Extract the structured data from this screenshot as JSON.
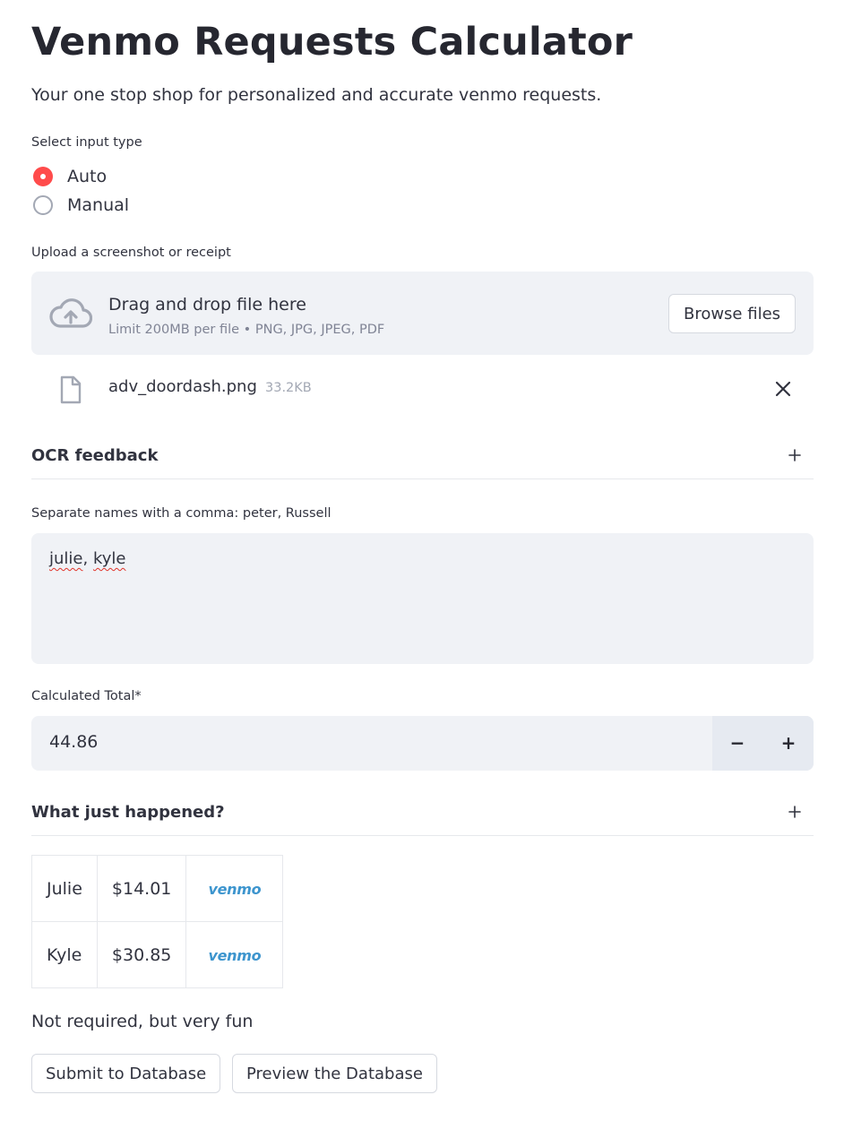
{
  "header": {
    "title": "Venmo Requests Calculator",
    "subtitle": "Your one stop shop for personalized and accurate venmo requests."
  },
  "input_type": {
    "label": "Select input type",
    "options": [
      {
        "label": "Auto",
        "selected": true
      },
      {
        "label": "Manual",
        "selected": false
      }
    ]
  },
  "uploader": {
    "label": "Upload a screenshot or receipt",
    "drag_text": "Drag and drop file here",
    "limit_text": "Limit 200MB per file • PNG, JPG, JPEG, PDF",
    "browse_label": "Browse files",
    "file": {
      "name": "adv_doordash.png",
      "size": "33.2KB"
    }
  },
  "ocr_expander": {
    "title": "OCR feedback"
  },
  "names": {
    "label": "Separate names with a comma: peter, Russell",
    "value_parts": [
      "julie",
      ", ",
      "kyle"
    ]
  },
  "total": {
    "label": "Calculated Total*",
    "value": "44.86",
    "minus": "−",
    "plus": "+"
  },
  "explain_expander": {
    "title": "What just happened?"
  },
  "requests": [
    {
      "name": "Julie",
      "amount": "$14.01",
      "link": "venmo"
    },
    {
      "name": "Kyle",
      "amount": "$30.85",
      "link": "venmo"
    }
  ],
  "footer": {
    "note": "Not required, but very fun",
    "submit_label": "Submit to Database",
    "preview_label": "Preview the Database"
  },
  "colors": {
    "accent": "#ff4b4b",
    "venmo": "#3d95ce",
    "input_bg": "#f0f2f6"
  }
}
